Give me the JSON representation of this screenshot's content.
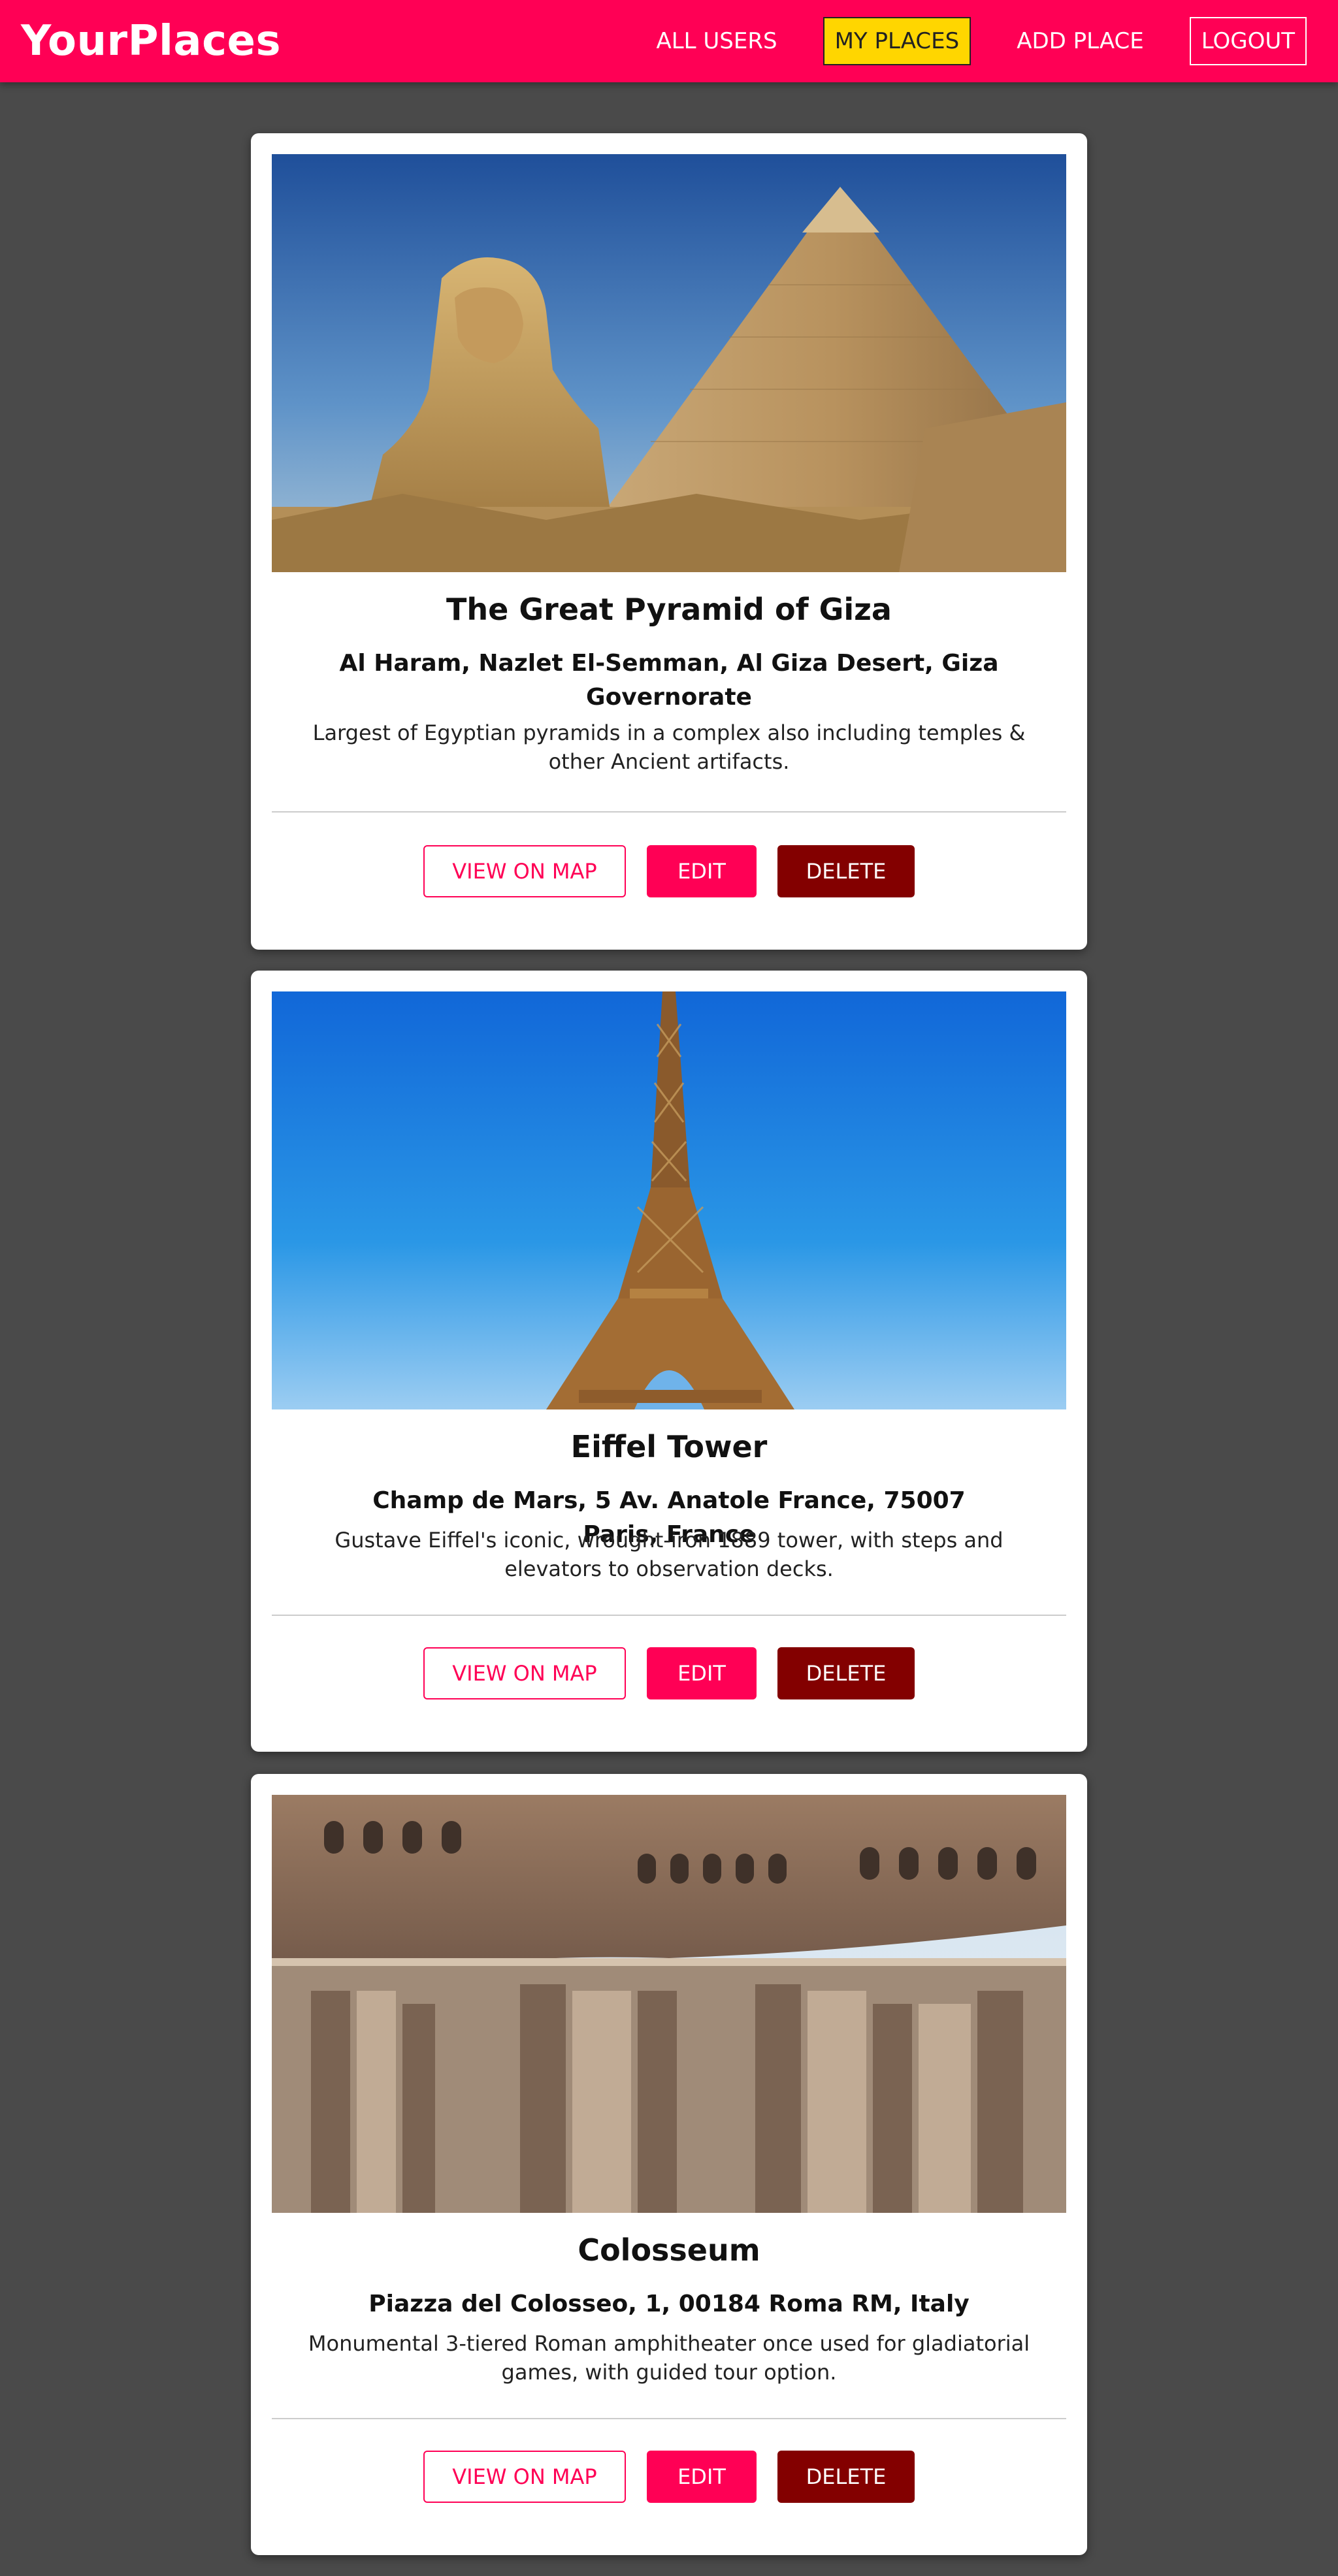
{
  "header": {
    "brand": "YourPlaces",
    "nav": [
      {
        "label": "ALL USERS"
      },
      {
        "label": "MY PLACES"
      },
      {
        "label": "ADD PLACE"
      },
      {
        "label": "LOGOUT"
      }
    ]
  },
  "places": [
    {
      "title": "The Great Pyramid of Giza",
      "address": "Al Haram, Nazlet El-Semman, Al Giza Desert, Giza Governorate",
      "description": "Largest of Egyptian pyramids in a complex also including temples & other Ancient artifacts.",
      "view_label": "VIEW ON MAP",
      "edit_label": "EDIT",
      "delete_label": "DELETE"
    },
    {
      "title": "Eiffel Tower",
      "address": "Champ de Mars, 5 Av. Anatole France, 75007 Paris, France",
      "description": "Gustave Eiffel's iconic, wrought-iron 1889 tower, with steps and elevators to observation decks.",
      "view_label": "VIEW ON MAP",
      "edit_label": "EDIT",
      "delete_label": "DELETE"
    },
    {
      "title": "Colosseum",
      "address": "Piazza del Colosseo, 1, 00184 Roma RM, Italy",
      "description": "Monumental 3-tiered Roman amphitheater once used for gladiatorial games, with guided tour option.",
      "view_label": "VIEW ON MAP",
      "edit_label": "EDIT",
      "delete_label": "DELETE"
    }
  ],
  "colors": {
    "brand": "#ff0055",
    "active_nav": "#ffd600",
    "delete": "#830000",
    "background": "#4a4a4a"
  }
}
